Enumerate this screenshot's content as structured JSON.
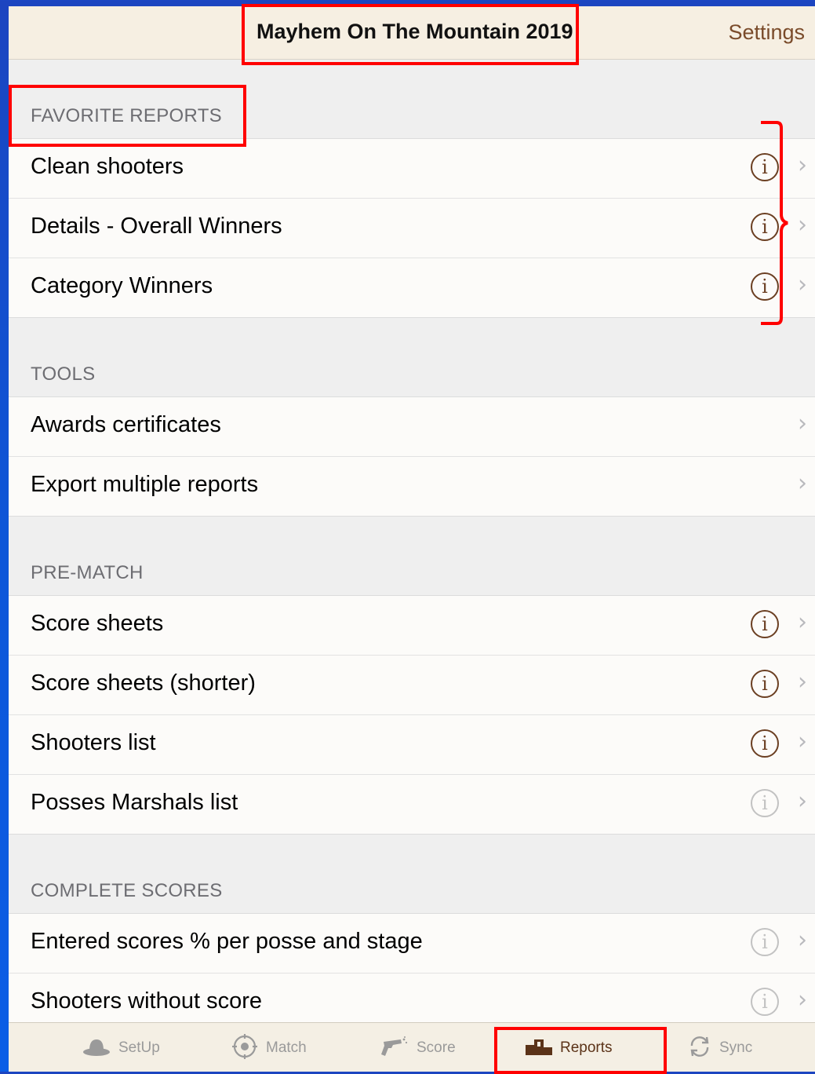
{
  "navbar": {
    "title": "Mayhem On The Mountain 2019",
    "settings_label": "Settings"
  },
  "sections": [
    {
      "header": "FAVORITE REPORTS",
      "rows": [
        {
          "label": "Clean shooters",
          "info": "active"
        },
        {
          "label": "Details - Overall Winners",
          "info": "active"
        },
        {
          "label": "Category Winners",
          "info": "active"
        }
      ]
    },
    {
      "header": "TOOLS",
      "rows": [
        {
          "label": "Awards certificates",
          "info": "none"
        },
        {
          "label": "Export multiple reports",
          "info": "none"
        }
      ]
    },
    {
      "header": "PRE-MATCH",
      "rows": [
        {
          "label": "Score sheets",
          "info": "active"
        },
        {
          "label": "Score sheets (shorter)",
          "info": "active"
        },
        {
          "label": "Shooters list",
          "info": "active"
        },
        {
          "label": "Posses Marshals list",
          "info": "dim"
        }
      ]
    },
    {
      "header": "COMPLETE SCORES",
      "rows": [
        {
          "label": "Entered scores % per posse and stage",
          "info": "dim"
        },
        {
          "label": "Shooters without score",
          "info": "dim"
        }
      ]
    }
  ],
  "tabbar": {
    "tabs": [
      {
        "label": "SetUp",
        "icon": "cowboy-hat-icon"
      },
      {
        "label": "Match",
        "icon": "crosshair-icon"
      },
      {
        "label": "Score",
        "icon": "revolver-icon"
      },
      {
        "label": "Reports",
        "icon": "podium-icon",
        "active": true
      },
      {
        "label": "Sync",
        "icon": "sync-icon"
      }
    ]
  },
  "colors": {
    "accent": "#7a4b2a",
    "annotation": "#ff0000",
    "background_frame": "#1c45c0"
  }
}
